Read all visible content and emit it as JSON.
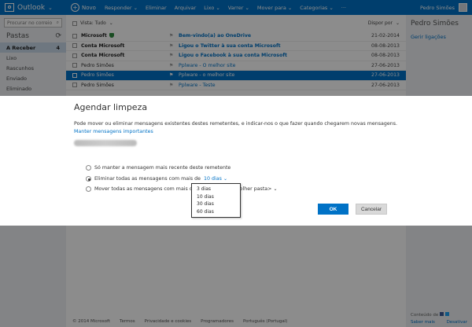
{
  "topbar": {
    "app_name": "Outlook",
    "logo_letter": "o",
    "new_label": "Novo",
    "reply_label": "Responder",
    "delete_label": "Eliminar",
    "archive_label": "Arquivar",
    "junk_label": "Lixo",
    "sweep_label": "Varrer",
    "move_label": "Mover para",
    "categories_label": "Categorias",
    "user_name": "Pedro Simões"
  },
  "left": {
    "search_placeholder": "Procurar no correio",
    "folders_title": "Pastas",
    "folders": [
      {
        "name": "A Receber",
        "count": "4",
        "active": true
      },
      {
        "name": "Lixo",
        "count": ""
      },
      {
        "name": "Rascunhos",
        "count": ""
      },
      {
        "name": "Enviado",
        "count": ""
      },
      {
        "name": "Eliminado",
        "count": ""
      }
    ]
  },
  "list": {
    "view_label": "Vista: Tudo",
    "sort_label": "Dispor por",
    "messages": [
      {
        "from": "Microsoft",
        "subject": "Bem-vindo(a) ao OneDrive",
        "date": "21-02-2014",
        "unread": true,
        "shield": true
      },
      {
        "from": "Conta Microsoft",
        "subject": "Ligou o Twitter à sua conta Microsoft",
        "date": "08-08-2013",
        "unread": true
      },
      {
        "from": "Conta Microsoft",
        "subject": "Ligou o Facebook à sua conta Microsoft",
        "date": "08-08-2013",
        "unread": true
      },
      {
        "from": "Pedro Simões",
        "subject": "Pplware - O melhor site",
        "date": "27-06-2013",
        "unread": false
      },
      {
        "from": "Pedro Simões",
        "subject": "Pplware - o melhor site",
        "date": "27-06-2013",
        "unread": false,
        "selected": true
      },
      {
        "from": "Pedro Simões",
        "subject": "Pplware - Teste",
        "date": "27-06-2013",
        "unread": false
      }
    ]
  },
  "right": {
    "name": "Pedro Simões",
    "link": "Gerir ligações",
    "ads_label": "Conteúdo de",
    "footer_links": [
      "Saber mais",
      "Desativar"
    ]
  },
  "footer": {
    "items": [
      "© 2014 Microsoft",
      "Termos",
      "Privacidade e cookies",
      "Programadores",
      "Português (Portugal)"
    ]
  },
  "dialog": {
    "title": "Agendar limpeza",
    "description": "Pode mover ou eliminar mensagens existentes destes remetentes, e indicar-nos o que fazer quando chegarem novas mensagens.",
    "manage_link": "Manter mensagens importantes",
    "option1": "Só manter a mensagem mais recente deste remetente",
    "option2_prefix": "Eliminar todas as mensagens com mais de",
    "option2_value": "10 dias",
    "option3_prefix": "Mover todas as mensagens com mais de 10 dias para",
    "option3_value": "Escolher pasta>",
    "ok_label": "OK",
    "cancel_label": "Cancelar",
    "dropdown_options": [
      "3 dias",
      "10 dias",
      "30 dias",
      "60 dias"
    ]
  }
}
